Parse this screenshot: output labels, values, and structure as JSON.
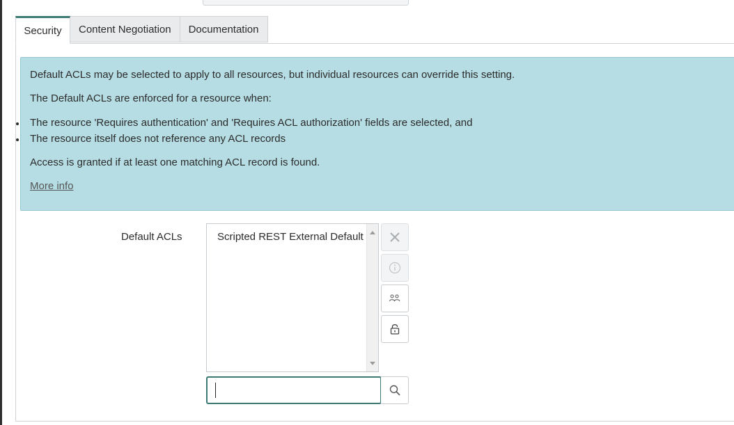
{
  "tabs": [
    "Security",
    "Content Negotiation",
    "Documentation"
  ],
  "info": {
    "line1": "Default ACLs may be selected to apply to all resources, but individual resources can override this setting.",
    "line2": "The Default ACLs are enforced for a resource when:",
    "bullets": [
      "The resource 'Requires authentication' and 'Requires ACL authorization' fields are selected, and",
      "The resource itself does not reference any ACL records"
    ],
    "line3": "Access is granted if at least one matching ACL record is found.",
    "more_info": "More info"
  },
  "field": {
    "label": "Default ACLs",
    "selected_items": [
      "Scripted REST External Default"
    ],
    "search_value": ""
  },
  "icons": {
    "remove": "close-icon",
    "info": "info-icon",
    "group": "users-icon",
    "lock": "lock-icon",
    "search": "search-icon"
  },
  "colors": {
    "accent": "#3b7a74",
    "info_bg": "#b5dde3",
    "tab_bg": "#e9ebed"
  }
}
